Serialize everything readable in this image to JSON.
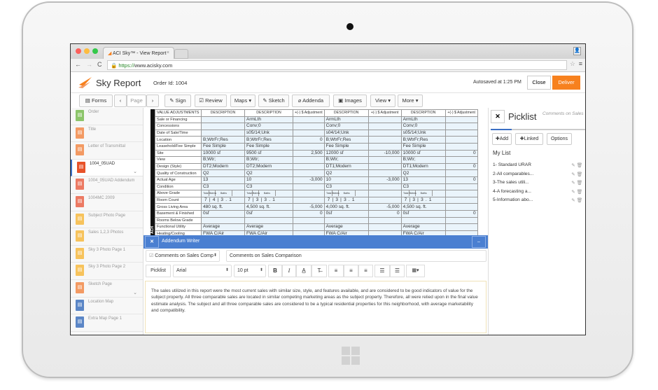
{
  "browser": {
    "tab_title": "ACI Sky™ - View Report",
    "url_scheme": "https://",
    "url_host": "www.acisky.com"
  },
  "header": {
    "app_name": "Sky Report",
    "order_id": "Order Id: 1004",
    "autosave": "Autosaved at 1:25 PM",
    "close": "Close",
    "deliver": "Deliver",
    "accent": "#f7811e"
  },
  "toolbar": {
    "forms": "Forms",
    "page": "Page",
    "sign": "Sign",
    "review": "Review",
    "maps": "Maps",
    "sketch": "Sketch",
    "addenda": "Addenda",
    "images": "Images",
    "view": "View",
    "more": "More"
  },
  "sidebar": {
    "items": [
      {
        "label": "Order",
        "color": "#8cc56a"
      },
      {
        "label": "Title",
        "color": "#f39a63"
      },
      {
        "label": "Letter of Transmittal",
        "color": "#f39a63"
      },
      {
        "label": "1004_05UAD",
        "color": "#e8532a",
        "active": true
      },
      {
        "label": "1004_05UAD Addendum",
        "color": "#ec7a63"
      },
      {
        "label": "1004MC 2009",
        "color": "#ec7a63"
      },
      {
        "label": "Subject Photo Page",
        "color": "#f7c35c"
      },
      {
        "label": "Sales 1,2,3 Photos",
        "color": "#f7c35c"
      },
      {
        "label": "Sky 3 Photo Page 1",
        "color": "#f7c35c"
      },
      {
        "label": "Sky 3 Photo Page 2",
        "color": "#f7c35c"
      },
      {
        "label": "Sketch Page",
        "color": "#f39a63"
      },
      {
        "label": "Location Map",
        "color": "#5b86c6"
      },
      {
        "label": "Extra Map Page 1",
        "color": "#5b86c6"
      }
    ]
  },
  "form": {
    "side_label": "ACH",
    "headers": [
      "VALUE ADJUSTMENTS",
      "DESCRIPTION",
      "DESCRIPTION",
      "+(-) $ Adjustment",
      "DESCRIPTION",
      "+(-) $ Adjustment",
      "DESCRIPTION",
      "+(-) $ Adjustment"
    ],
    "room_labels": [
      "Total",
      "Bdrms",
      "Baths"
    ],
    "rows": [
      [
        "Sale or Financing",
        "",
        "ArmLth",
        "",
        "ArmLth",
        "",
        "ArmLth",
        ""
      ],
      [
        "Concessions",
        "",
        "Conv;0",
        "",
        "Conv;0",
        "",
        "Conv;0",
        ""
      ],
      [
        "Date of Sale/Time",
        "",
        "s05/14;Unk",
        "",
        "s04/14;Unk",
        "",
        "s05/14;Unk",
        ""
      ],
      [
        "Location",
        "B;WtrFr;Res",
        "B;WtrFr;Res",
        "0",
        "B;WtrFr;Res",
        "",
        "B;WtrFr;Res",
        ""
      ],
      [
        "Leasehold/Fee Simple",
        "Fee Simple",
        "Fee Simple",
        "",
        "Fee Simple",
        "",
        "Fee Simple",
        ""
      ],
      [
        "Site",
        "10000 sf",
        "9500 sf",
        "2,500",
        "12000 sf",
        "-10,000",
        "10000 sf",
        "0"
      ],
      [
        "View",
        "B;Wtr;",
        "B;Wtr;",
        "",
        "B;Wtr;",
        "",
        "B;Wtr;",
        ""
      ],
      [
        "Design (Style)",
        "DT2;Modern",
        "DT2;Modern",
        "",
        "DT1;Modern",
        "",
        "DT1;Modern",
        "0"
      ],
      [
        "Quality of Construction",
        "Q2",
        "Q2",
        "",
        "Q2",
        "",
        "Q2",
        ""
      ],
      [
        "Actual Age",
        "13",
        "10",
        "-3,000",
        "10",
        "-3,000",
        "13",
        "0"
      ],
      [
        "Condition",
        "C3",
        "C3",
        "",
        "C3",
        "",
        "C3",
        ""
      ],
      [
        "Above Grade",
        "@labels",
        "@labels",
        "",
        "@labels",
        "",
        "@labels",
        ""
      ],
      [
        "Room Count",
        "7|4|3.1",
        "7|3|3.1",
        "",
        "7|3|3.1",
        "",
        "7|3|3.1",
        ""
      ],
      [
        "Gross Living Area",
        "480 sq. ft.",
        "4,500 sq. ft.",
        "-5,000",
        "4,000 sq. ft.",
        "-5,000",
        "4,500 sq. ft.",
        ""
      ],
      [
        "Basement & Finished",
        "0sf",
        "0sf",
        "0",
        "0sf",
        "0",
        "0sf",
        "0"
      ],
      [
        "Rooms Below Grade",
        "",
        "",
        "",
        "",
        "",
        "",
        ""
      ],
      [
        "Functional Utility",
        "Average",
        "Average",
        "",
        "Average",
        "",
        "Average",
        ""
      ],
      [
        "Heating/Cooling",
        "FWA C/Air",
        "FWA C/Air",
        "",
        "FWA C/Air",
        "",
        "FWA C/Air",
        ""
      ]
    ]
  },
  "addendum": {
    "title": "Addendum Writer",
    "section_select": "Comments on Sales Comp",
    "section_title": "Comments on Sales Comparison",
    "picklist": "Picklist",
    "font": "Arial",
    "size": "10 pt",
    "text": "The sales utilized in this report were the most current sales with similar size, style, and features available, and are considered to be good indicators of value for the subject property. All three comparable sales are located in similar competing marketing areas as the subject property. Therefore, all were relied upon in the final value estimate analysis. The subject and all three comparable sales are considered to be a typical residential properties for this neighborhood, with average marketability and compatibility.",
    "header_color": "#4a7fd1"
  },
  "picklist": {
    "title": "Picklist",
    "subtitle": "Comments on Sales",
    "add": "Add",
    "linked": "Linked",
    "options": "Options",
    "my_list": "My List",
    "items": [
      "1- Standard URAR",
      "2-All comparables...",
      "3-The sales utili...",
      "4-A forecasting a...",
      "5-Information abo..."
    ]
  }
}
